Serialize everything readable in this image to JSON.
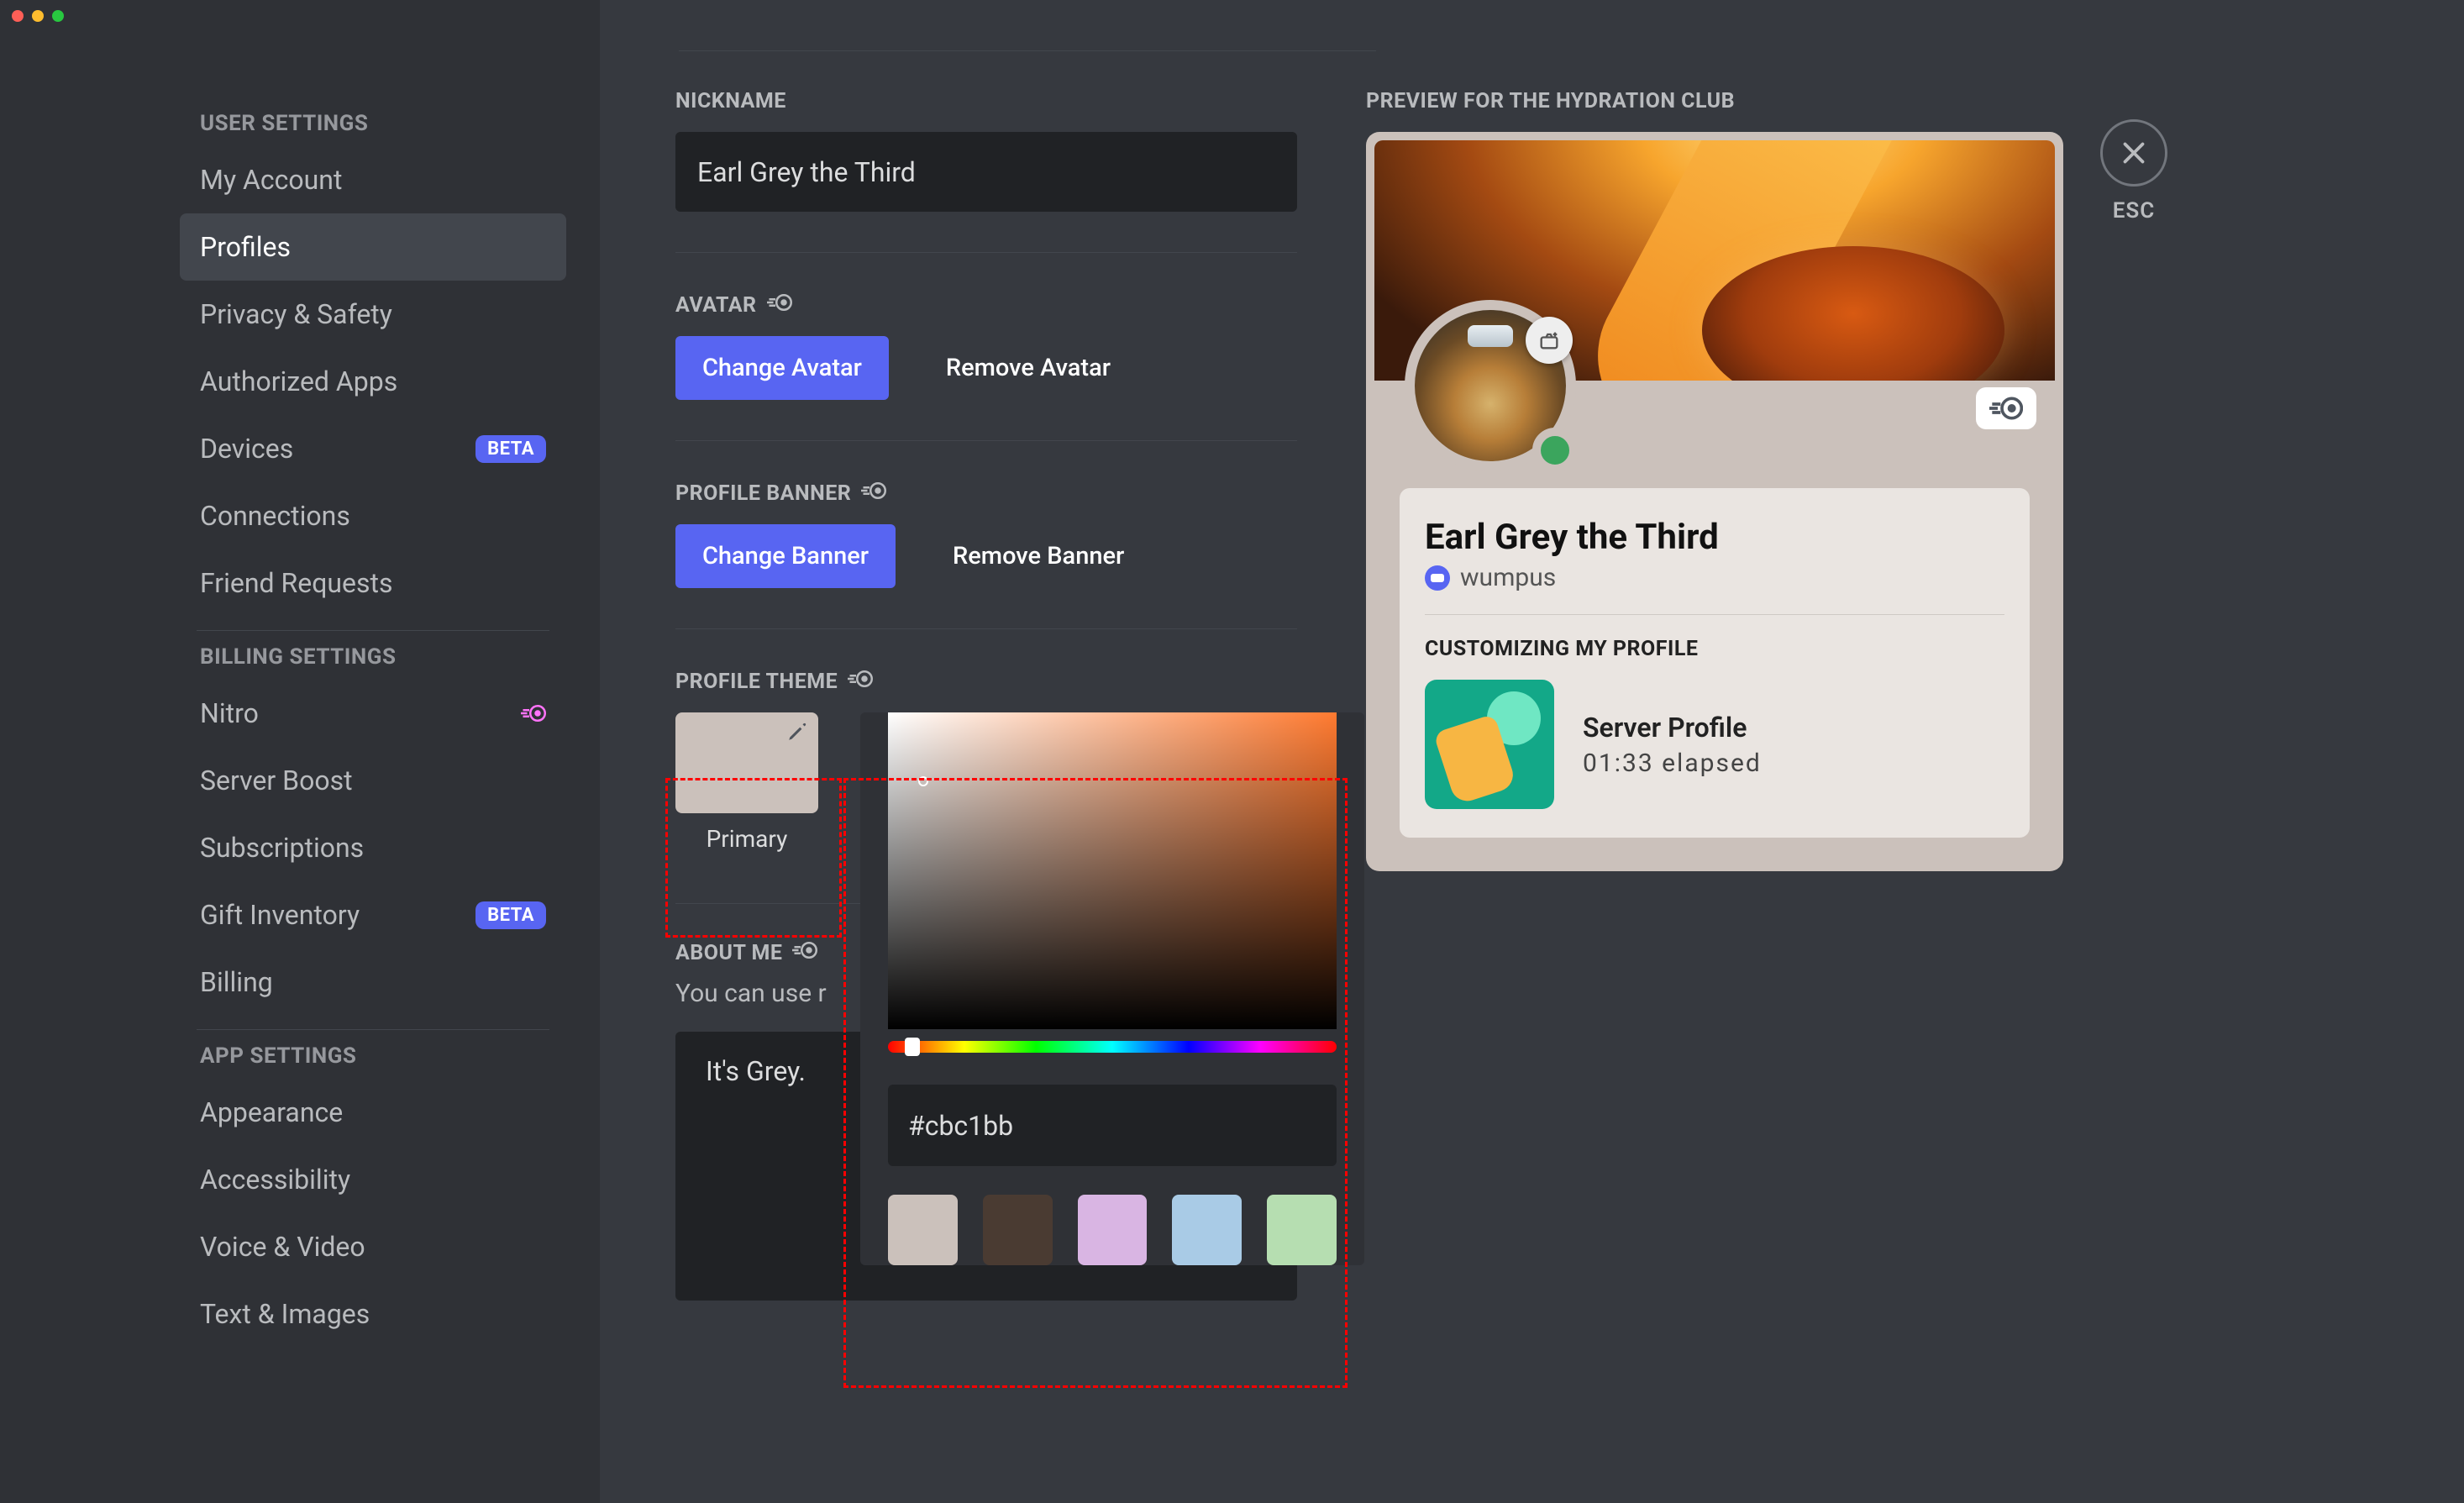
{
  "sidebar": {
    "user_settings_heading": "User Settings",
    "billing_settings_heading": "Billing Settings",
    "app_settings_heading": "App Settings",
    "items": {
      "my_account": "My Account",
      "profiles": "Profiles",
      "privacy": "Privacy & Safety",
      "authorized_apps": "Authorized Apps",
      "devices": "Devices",
      "connections": "Connections",
      "friend_requests": "Friend Requests",
      "nitro": "Nitro",
      "server_boost": "Server Boost",
      "subscriptions": "Subscriptions",
      "gift_inventory": "Gift Inventory",
      "billing": "Billing",
      "appearance": "Appearance",
      "accessibility": "Accessibility",
      "voice_video": "Voice & Video",
      "text_images": "Text & Images"
    },
    "beta_badge": "BETA"
  },
  "main": {
    "nickname_label": "Nickname",
    "nickname_value": "Earl Grey the Third",
    "avatar_label": "Avatar",
    "change_avatar": "Change Avatar",
    "remove_avatar": "Remove Avatar",
    "profile_banner_label": "Profile Banner",
    "change_banner": "Change Banner",
    "remove_banner": "Remove Banner",
    "profile_theme_label": "Profile Theme",
    "primary_label": "Primary",
    "about_me_label": "About Me",
    "about_me_desc_truncated": "You can use r",
    "about_me_value": "It's Grey.",
    "picker": {
      "hex": "#cbc1bb",
      "presets": [
        "#cbc1bb",
        "#4a3b32",
        "#d9b5e3",
        "#a9cbe6",
        "#b6deb1"
      ]
    }
  },
  "preview": {
    "heading": "Preview for The Hydration Club",
    "display_name": "Earl Grey the Third",
    "username": "wumpus",
    "customizing_heading": "Customizing My Profile",
    "activity_title": "Server Profile",
    "activity_elapsed": "01:33 elapsed"
  },
  "close_label": "ESC"
}
